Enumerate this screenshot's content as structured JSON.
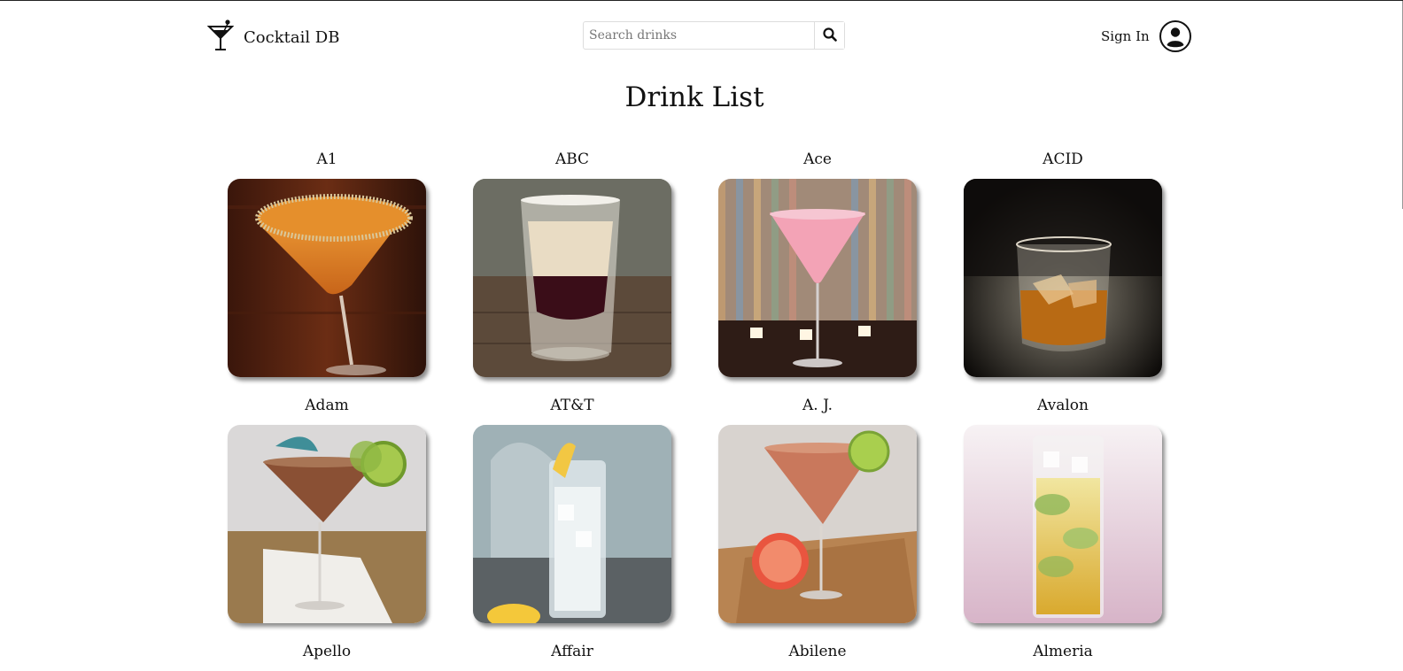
{
  "header": {
    "brand_name": "Cocktail DB",
    "brand_icon": "cocktail-glass-icon",
    "search_placeholder": "Search drinks",
    "search_icon": "search-icon",
    "sign_in_label": "Sign In",
    "avatar_icon": "user-circle-icon"
  },
  "main": {
    "title": "Drink List",
    "drinks": [
      {
        "name": "A1",
        "image": "orange-martini-sugar-rim"
      },
      {
        "name": "ABC",
        "image": "layered-shot"
      },
      {
        "name": "Ace",
        "image": "pink-martini-candles"
      },
      {
        "name": "ACID",
        "image": "whiskey-on-rocks"
      },
      {
        "name": "Adam",
        "image": "martini-umbrella-lime"
      },
      {
        "name": "AT&T",
        "image": "highball-lemon"
      },
      {
        "name": "A. J.",
        "image": "martini-grapefruit"
      },
      {
        "name": "Avalon",
        "image": "highball-cucumber"
      },
      {
        "name": "Apello",
        "image": ""
      },
      {
        "name": "Affair",
        "image": ""
      },
      {
        "name": "Abilene",
        "image": ""
      },
      {
        "name": "Almeria",
        "image": ""
      }
    ]
  }
}
